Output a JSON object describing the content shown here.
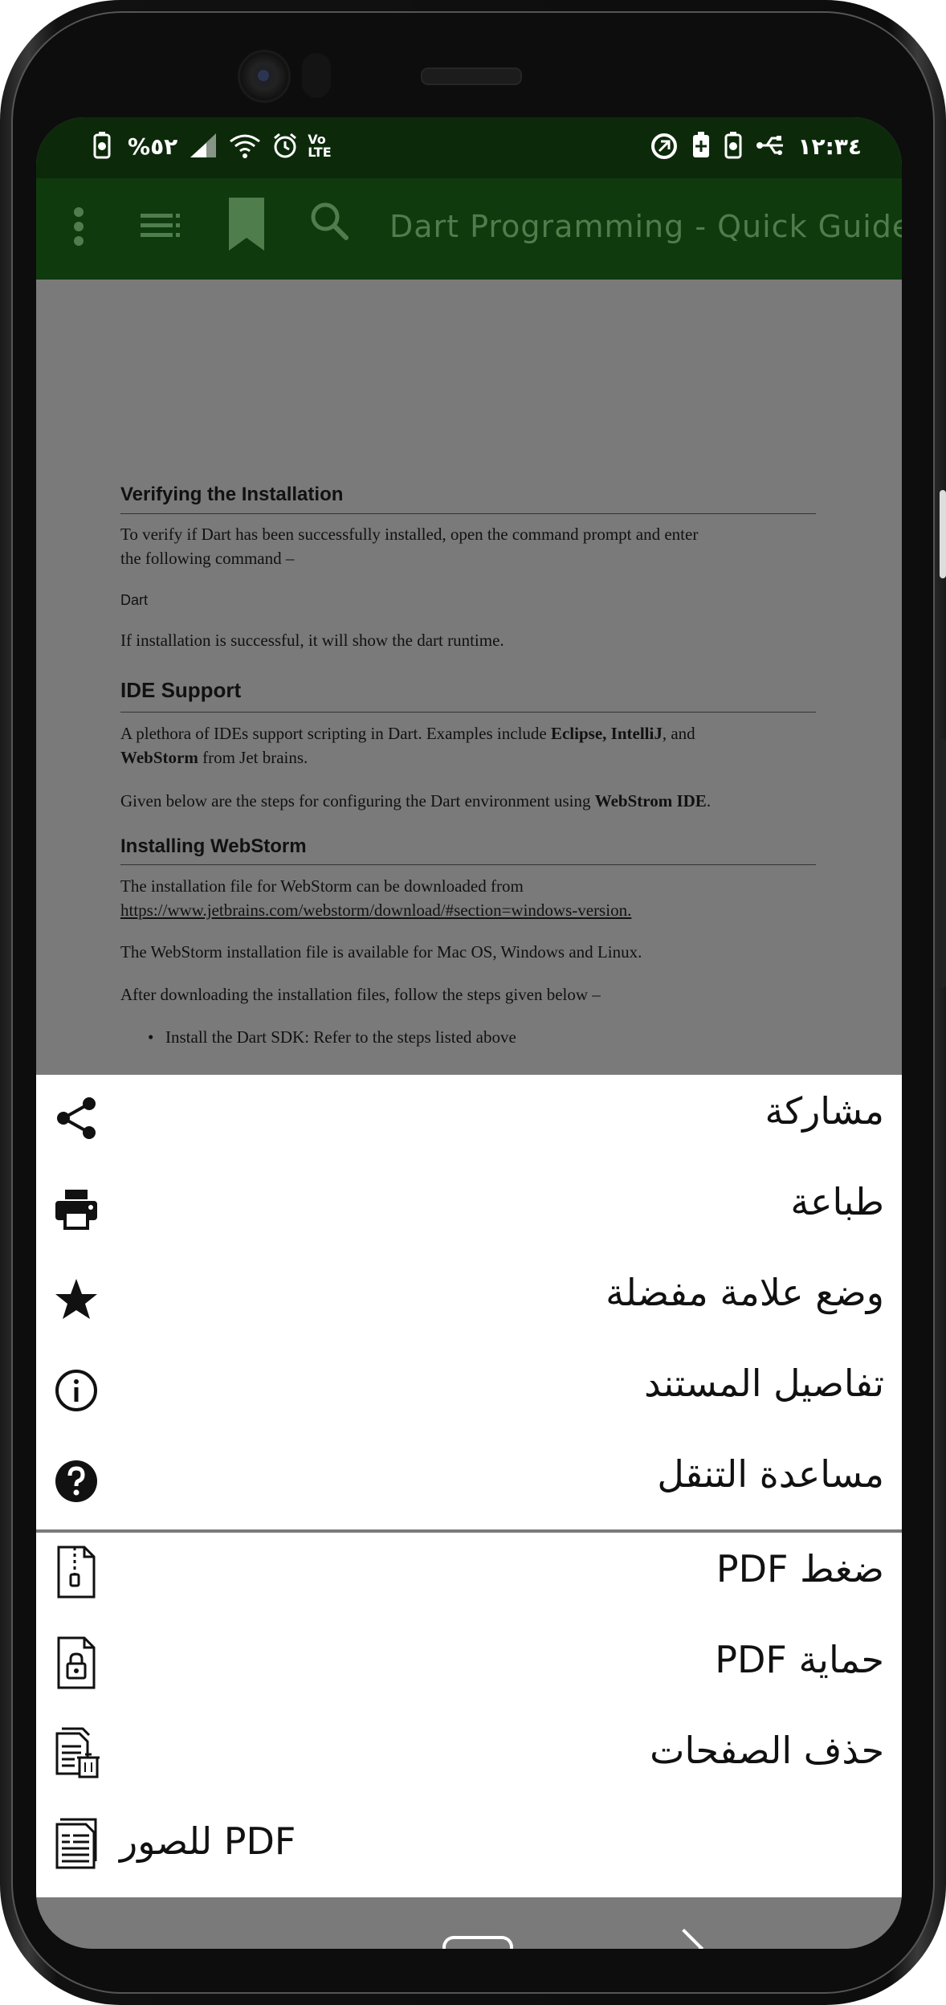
{
  "status_bar": {
    "battery_percent": "%٥٢",
    "time": "١٢:٣٤",
    "volte_top": "Vo",
    "volte_bottom": "LTE"
  },
  "toolbar": {
    "title": "Dart Programming - Quick Guide",
    "icons": [
      "more-vert-icon",
      "list-icon",
      "bookmark-icon",
      "search-icon"
    ]
  },
  "document": {
    "section1_heading": "Verifying the Installation",
    "section1_p1_line1": "To verify if Dart has been successfully installed, open the command prompt and enter",
    "section1_p1_line2": "the following command –",
    "section1_code": "Dart",
    "section1_p2": "If installation is successful, it will show the dart runtime.",
    "section2_heading": "IDE Support",
    "section2_p1_line1_a": "A plethora of IDEs support scripting in Dart. Examples include ",
    "section2_p1_line1_b": "Eclipse, IntelliJ",
    "section2_p1_line1_c": ", and",
    "section2_p1_line2_a": "WebStorm",
    "section2_p1_line2_b": " from Jet brains.",
    "section2_p2_a": "Given below are the steps for configuring the Dart environment using ",
    "section2_p2_b": "WebStrom IDE",
    "section2_p2_c": ".",
    "section3_heading": "Installing WebStorm",
    "section3_p1_line1": "The installation file for WebStorm can be downloaded from",
    "section3_p1_link": "https://www.jetbrains.com/webstorm/download/#section=windows-version.",
    "section3_p2": "The WebStorm installation file is available for Mac OS, Windows and Linux.",
    "section3_p3": "After downloading the installation files, follow the steps given below –",
    "section3_bullet1": "Install the Dart SDK: Refer to the steps listed above"
  },
  "menu": {
    "items": [
      {
        "label": "مشاركة",
        "icon": "share-icon"
      },
      {
        "label": "طباعة",
        "icon": "print-icon"
      },
      {
        "label": "وضع علامة مفضلة",
        "icon": "star-icon"
      },
      {
        "label": "تفاصيل المستند",
        "icon": "info-icon"
      },
      {
        "label": "مساعدة التنقل",
        "icon": "help-icon"
      },
      {
        "label": "ضغط PDF",
        "icon": "zip-file-icon"
      },
      {
        "label": "حماية PDF",
        "icon": "lock-file-icon"
      },
      {
        "label": "حذف الصفحات",
        "icon": "delete-pages-icon"
      },
      {
        "label": "PDF للصور",
        "icon": "pdf-to-images-icon"
      }
    ]
  }
}
